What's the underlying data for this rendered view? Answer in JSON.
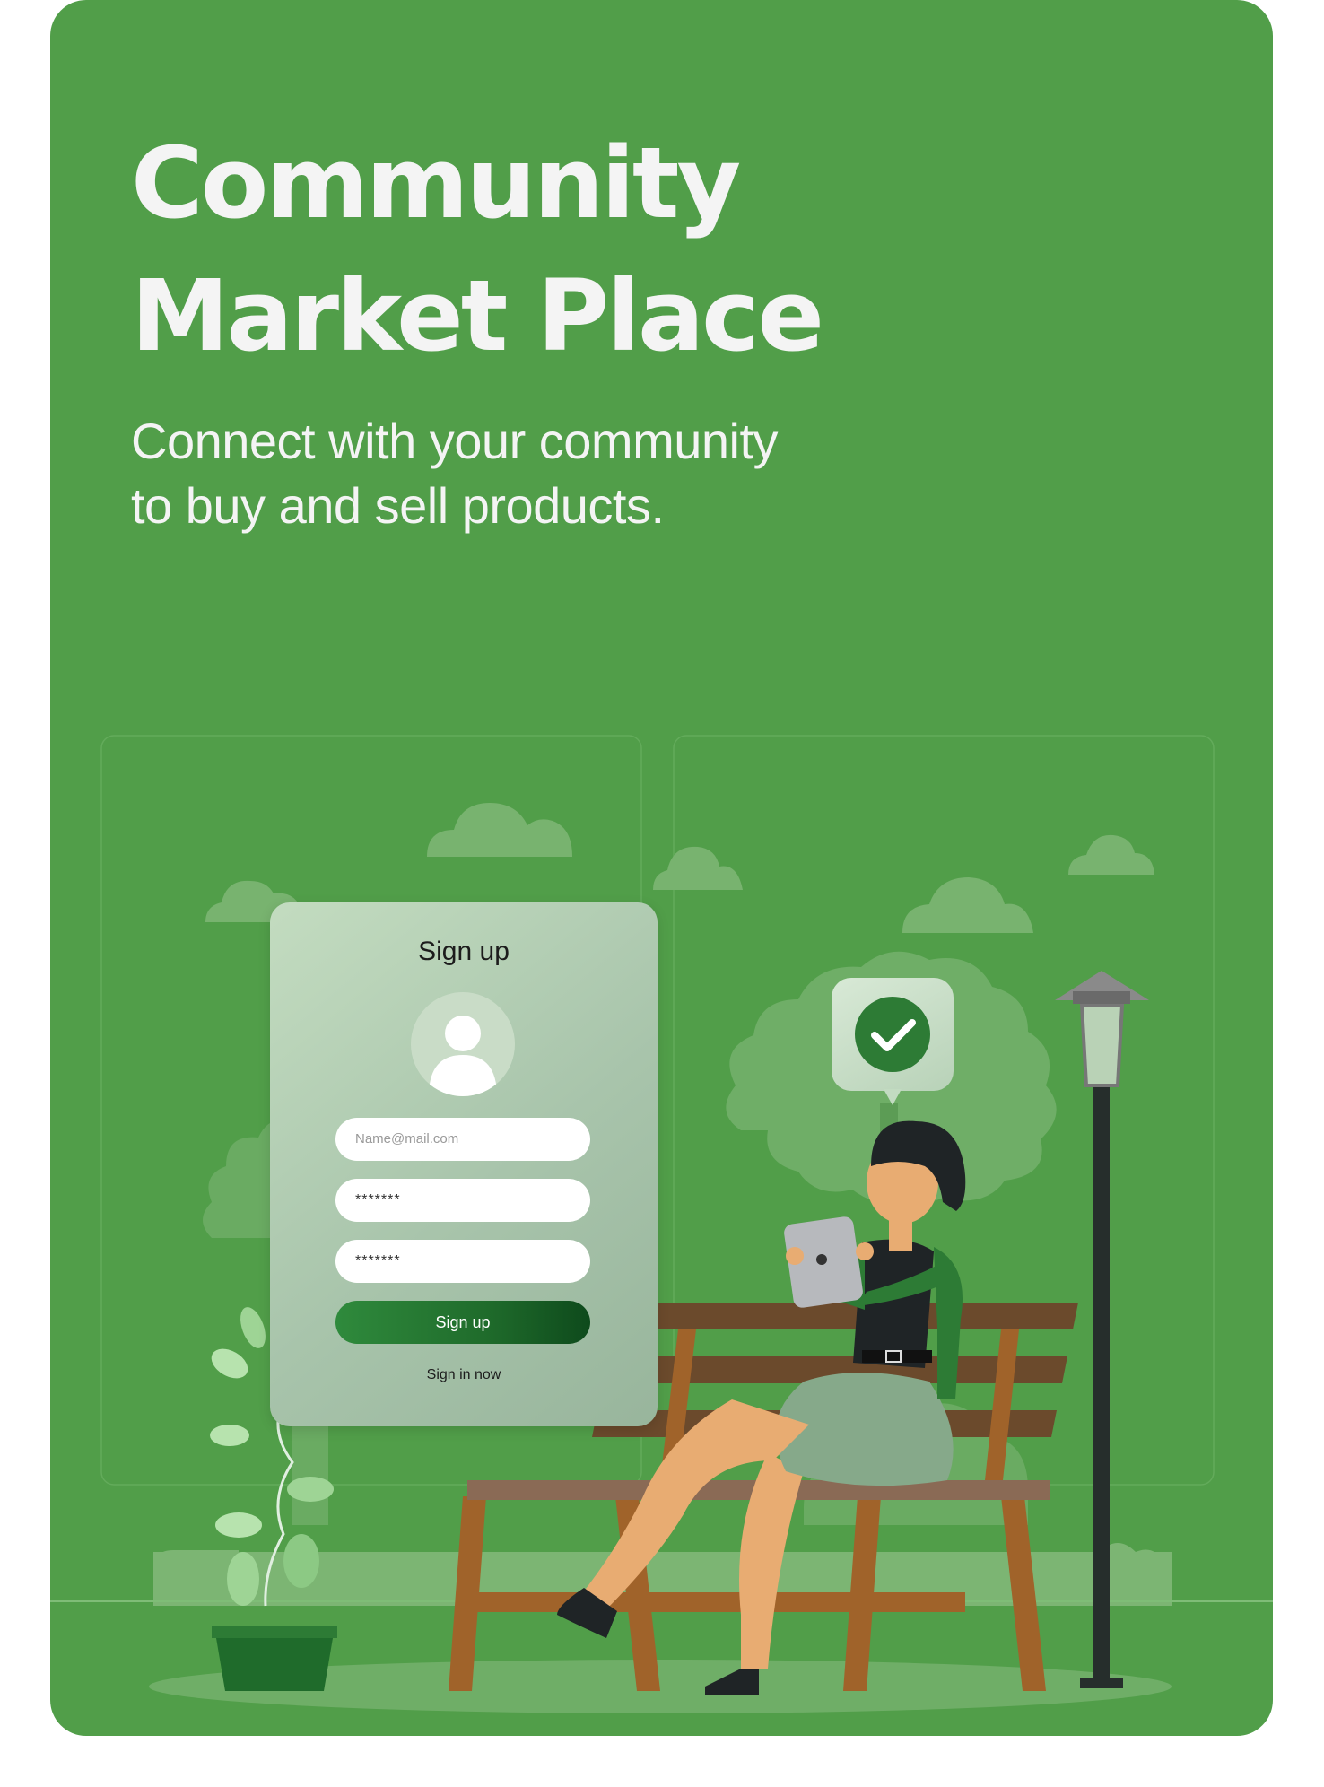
{
  "hero": {
    "title_line1": "Community",
    "title_line2": "Market Place",
    "subtitle_line1": "Connect with your community",
    "subtitle_line2": "to buy and sell products."
  },
  "signup_form": {
    "title": "Sign up",
    "email_placeholder": "Name@mail.com",
    "password_value": "*******",
    "confirm_password_value": "*******",
    "submit_label": "Sign up",
    "signin_link": "Sign in now"
  },
  "colors": {
    "background_green": "#519e49",
    "button_dark_green": "#1f6b2b",
    "title_text": "#f4f4f4"
  },
  "icons": [
    "user-avatar-icon",
    "check-icon",
    "cloud-icon",
    "tree-icon",
    "plant-pot-icon",
    "street-lamp-icon",
    "tablet-icon",
    "bench-icon"
  ]
}
